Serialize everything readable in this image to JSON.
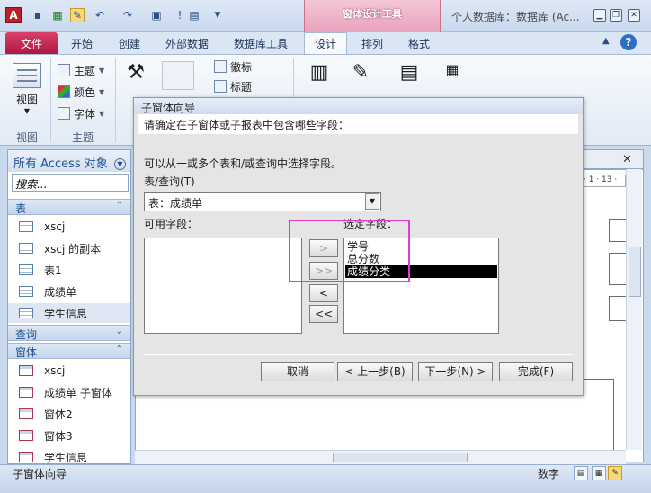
{
  "titlebar": {
    "app_icon": "A",
    "contextual_group": "窗体设计工具",
    "title": "个人数据库：数据库 (Ac...",
    "window_buttons": [
      "minimize-icon",
      "restore-icon",
      "close-icon"
    ],
    "quick_access": [
      "save-icon",
      "excel-icon",
      "design-view-icon",
      "undo-icon",
      "redo-icon",
      "refresh-icon",
      "help-icon",
      "form-icon",
      "customize-icon"
    ]
  },
  "ribbon": {
    "tabs": {
      "file": "文件",
      "home": "开始",
      "create": "创建",
      "external": "外部数据",
      "dbtools": "数据库工具",
      "design": "设计",
      "arrange": "排列",
      "format": "格式"
    },
    "active_tab": "设计",
    "views": {
      "view_label": "视图",
      "group_label": "视图"
    },
    "themes": {
      "theme": "主题",
      "colors": "颜色",
      "fonts": "字体",
      "group_label": "主题"
    },
    "header": {
      "logo": "徽标",
      "title": "标题"
    }
  },
  "nav": {
    "header": "所有 Access 对象",
    "search_placeholder": "搜索...",
    "categories": {
      "tables": "表",
      "queries": "查询",
      "forms": "窗体"
    },
    "tables": [
      "xscj",
      "xscj 的副本",
      "表1",
      "成绩单",
      "学生信息"
    ],
    "forms": [
      "xscj",
      "成绩单 子窗体",
      "窗体2",
      "窗体3",
      "学生信息"
    ]
  },
  "doc": {
    "ruler_label": "· 1 · 13 ·"
  },
  "status": {
    "text": "子窗体向导",
    "mode": "数字"
  },
  "dialog": {
    "title": "子窗体向导",
    "question": "请确定在子窗体或子报表中包含哪些字段：",
    "description": "可以从一或多个表和/或查询中选择字段。",
    "tables_label": "表/查询(T)",
    "tables_value": "表：成绩单",
    "available_label": "可用字段：",
    "selected_label": "选定字段：",
    "selected_fields": [
      "学号",
      "总分数",
      "成绩分类"
    ],
    "selected_index": 2,
    "buttons": {
      "add": ">",
      "add_all": ">>",
      "remove": "<",
      "remove_all": "<<",
      "cancel": "取消",
      "back": "< 上一步(B)",
      "next": "下一步(N) >",
      "finish": "完成(F)"
    }
  },
  "colors": {
    "file_tab": "#b1183f",
    "contextual_band": "#e9a2bd",
    "highlight": "#e23ad2",
    "selection": "#000000"
  }
}
